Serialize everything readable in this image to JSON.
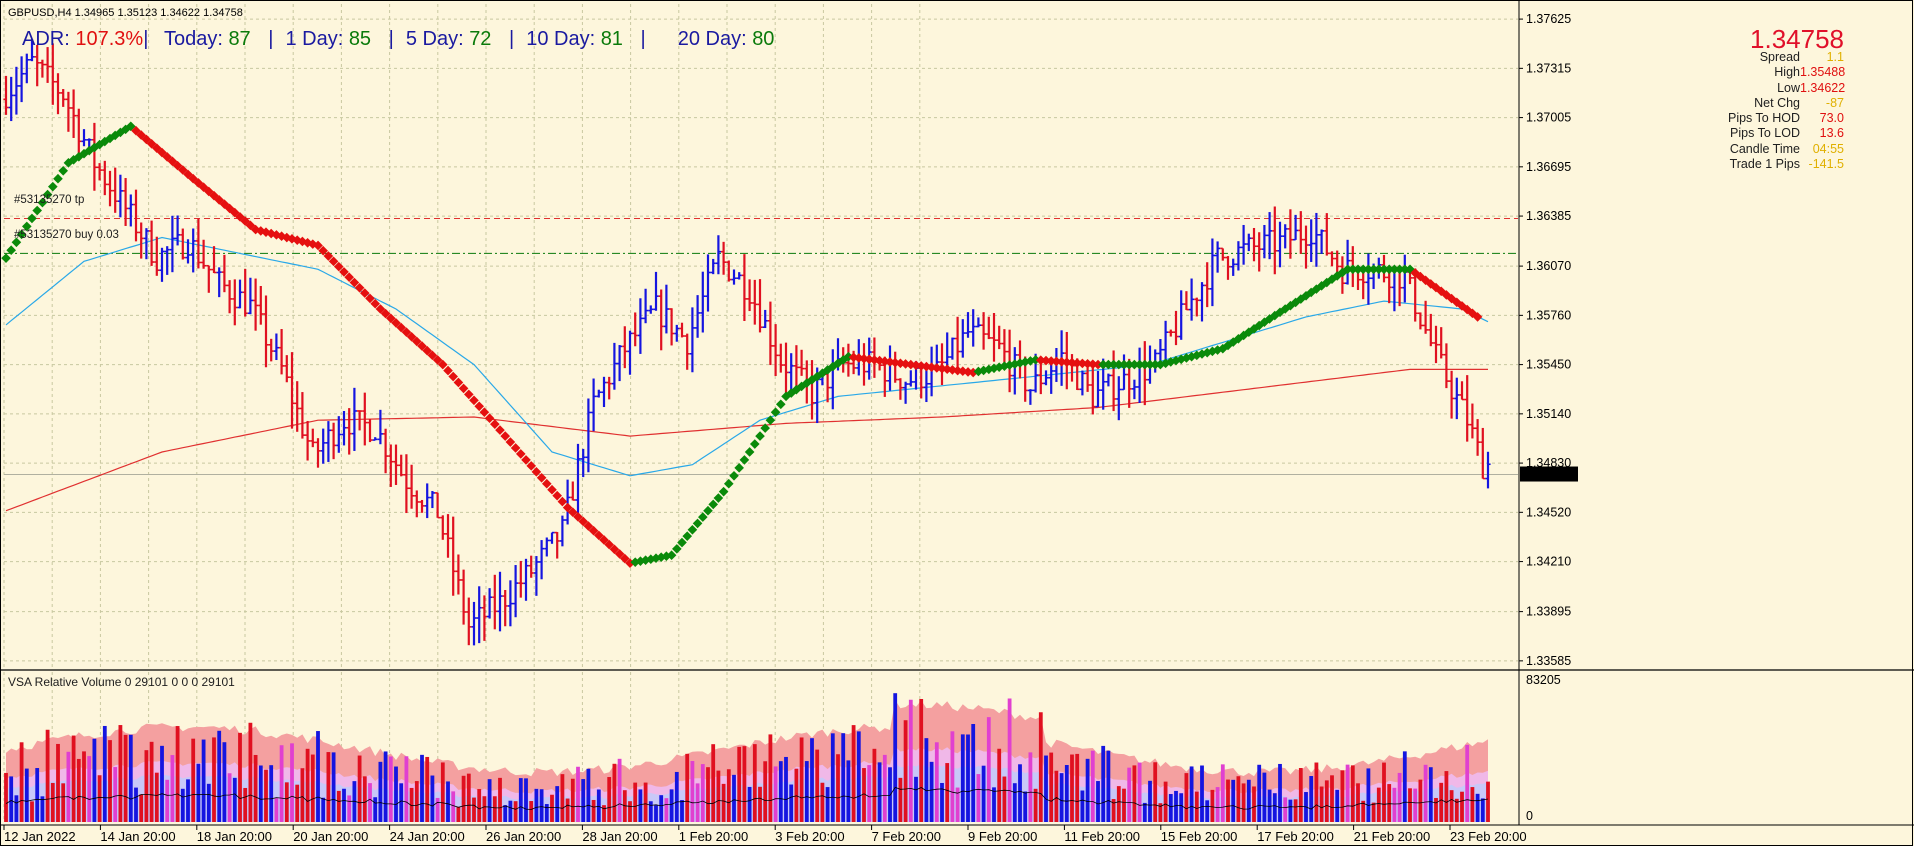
{
  "header": {
    "symbol_line": "GBPUSD,H4  1.34965 1.35123 1.34622 1.34758",
    "adr_label": "ADR: ",
    "adr_value": "107.3%",
    "today_label": "Today: ",
    "today_value": "87",
    "d1_label": "1 Day: ",
    "d1_value": "85",
    "d5_label": "5 Day: ",
    "d5_value": "72",
    "d10_label": "10 Day: ",
    "d10_value": "81",
    "d20_label": "20 Day: ",
    "d20_value": "80",
    "sep": "|"
  },
  "info_panel": {
    "price": "1.34758",
    "rows": [
      {
        "label": "Spread",
        "value": "1.1",
        "color": "yel"
      },
      {
        "label": "High",
        "value": "1.35488",
        "color": "red"
      },
      {
        "label": "Low",
        "value": "1.34622",
        "color": "red"
      },
      {
        "label": "Net Chg",
        "value": "-87",
        "color": "yel"
      },
      {
        "label": "Pips To HOD",
        "value": "73.0",
        "color": "red"
      },
      {
        "label": "Pips To LOD",
        "value": "13.6",
        "color": "red"
      },
      {
        "label": "Candle Time",
        "value": "04:55",
        "color": "yel"
      },
      {
        "label": "Trade 1 Pips",
        "value": "-141.5",
        "color": "yel"
      }
    ]
  },
  "orders": {
    "tp_label": "#53135270 tp",
    "buy_label": "#53135270 buy 0.03"
  },
  "volume_panel": {
    "title": "VSA Relative Volume 0 29101 0 0 0 29101",
    "axis_top": "83205",
    "axis_bottom": "0"
  },
  "colors": {
    "background": "#fdf6dc",
    "bull_bar": "#1515e0",
    "bear_bar": "#e01020",
    "ma_up": "#0a8a0a",
    "ma_down": "#e51010",
    "ma_fast": "#29a8e8",
    "ma_slow": "#e03030",
    "grid": "#c8c8a0",
    "vol_band_outer": "#f4a0a0",
    "vol_band_mid": "#f0b8e8",
    "vol_band_inner": "#c8c8f8",
    "vol_ma": "#000000"
  },
  "chart_data": {
    "type": "candlestick-bars",
    "symbol": "GBPUSD",
    "timeframe": "H4",
    "price_axis": {
      "ticks": [
        "1.37625",
        "1.37315",
        "1.37005",
        "1.36695",
        "1.36385",
        "1.36070",
        "1.35760",
        "1.35450",
        "1.35140",
        "1.34830",
        "1.34520",
        "1.34210",
        "1.33895",
        "1.33585"
      ],
      "ylim": [
        1.3354,
        1.3772
      ],
      "current_price": "1.34758"
    },
    "time_axis": {
      "ticks": [
        "12 Jan 2022",
        "14 Jan 20:00",
        "18 Jan 20:00",
        "20 Jan 20:00",
        "24 Jan 20:00",
        "26 Jan 20:00",
        "28 Jan 20:00",
        "1 Feb 20:00",
        "3 Feb 20:00",
        "7 Feb 20:00",
        "9 Feb 20:00",
        "11 Feb 20:00",
        "15 Feb 20:00",
        "17 Feb 20:00",
        "21 Feb 20:00",
        "23 Feb 20:00"
      ]
    },
    "levels": {
      "take_profit": 1.3637,
      "buy_entry": 1.3615
    },
    "price_anchors": [
      [
        0,
        1.3712
      ],
      [
        6,
        1.3735
      ],
      [
        12,
        1.3715
      ],
      [
        18,
        1.3672
      ],
      [
        24,
        1.3643
      ],
      [
        30,
        1.3612
      ],
      [
        36,
        1.3623
      ],
      [
        42,
        1.3596
      ],
      [
        48,
        1.3582
      ],
      [
        54,
        1.3542
      ],
      [
        60,
        1.3488
      ],
      [
        66,
        1.351
      ],
      [
        72,
        1.3505
      ],
      [
        78,
        1.3472
      ],
      [
        84,
        1.3452
      ],
      [
        90,
        1.338
      ],
      [
        96,
        1.3395
      ],
      [
        102,
        1.3415
      ],
      [
        108,
        1.344
      ],
      [
        114,
        1.352
      ],
      [
        120,
        1.3555
      ],
      [
        126,
        1.358
      ],
      [
        132,
        1.356
      ],
      [
        138,
        1.3612
      ],
      [
        144,
        1.3592
      ],
      [
        150,
        1.3548
      ],
      [
        156,
        1.3527
      ],
      [
        162,
        1.3545
      ],
      [
        168,
        1.3545
      ],
      [
        174,
        1.3535
      ],
      [
        180,
        1.354
      ],
      [
        186,
        1.3565
      ],
      [
        192,
        1.3555
      ],
      [
        198,
        1.353
      ],
      [
        204,
        1.355
      ],
      [
        210,
        1.3525
      ],
      [
        216,
        1.3535
      ],
      [
        222,
        1.3545
      ],
      [
        228,
        1.358
      ],
      [
        234,
        1.3612
      ],
      [
        240,
        1.3618
      ],
      [
        246,
        1.3622
      ],
      [
        252,
        1.363
      ],
      [
        258,
        1.3605
      ],
      [
        264,
        1.3605
      ],
      [
        270,
        1.36
      ],
      [
        276,
        1.355
      ],
      [
        282,
        1.351
      ],
      [
        285,
        1.3482
      ]
    ],
    "ma_trend_anchors": [
      [
        0,
        1.3612
      ],
      [
        12,
        1.3672
      ],
      [
        24,
        1.3695
      ],
      [
        36,
        1.3662
      ],
      [
        48,
        1.363
      ],
      [
        60,
        1.362
      ],
      [
        72,
        1.358
      ],
      [
        84,
        1.3545
      ],
      [
        96,
        1.35
      ],
      [
        108,
        1.3455
      ],
      [
        120,
        1.342
      ],
      [
        128,
        1.3425
      ],
      [
        138,
        1.3465
      ],
      [
        150,
        1.3525
      ],
      [
        162,
        1.355
      ],
      [
        174,
        1.3545
      ],
      [
        186,
        1.354
      ],
      [
        198,
        1.3548
      ],
      [
        210,
        1.3545
      ],
      [
        222,
        1.3545
      ],
      [
        234,
        1.3555
      ],
      [
        246,
        1.358
      ],
      [
        258,
        1.3605
      ],
      [
        270,
        1.3605
      ],
      [
        283,
        1.3575
      ]
    ],
    "ma_fast_anchors": [
      [
        0,
        1.357
      ],
      [
        15,
        1.361
      ],
      [
        30,
        1.3625
      ],
      [
        45,
        1.3615
      ],
      [
        60,
        1.3605
      ],
      [
        75,
        1.358
      ],
      [
        90,
        1.3545
      ],
      [
        105,
        1.349
      ],
      [
        120,
        1.3475
      ],
      [
        132,
        1.3482
      ],
      [
        145,
        1.351
      ],
      [
        160,
        1.3525
      ],
      [
        175,
        1.353
      ],
      [
        190,
        1.3535
      ],
      [
        205,
        1.354
      ],
      [
        220,
        1.3545
      ],
      [
        235,
        1.356
      ],
      [
        250,
        1.3575
      ],
      [
        265,
        1.3585
      ],
      [
        280,
        1.358
      ],
      [
        285,
        1.3572
      ]
    ],
    "ma_slow_anchors": [
      [
        0,
        1.3453
      ],
      [
        30,
        1.349
      ],
      [
        60,
        1.351
      ],
      [
        90,
        1.3512
      ],
      [
        120,
        1.35
      ],
      [
        150,
        1.3508
      ],
      [
        180,
        1.3512
      ],
      [
        210,
        1.3518
      ],
      [
        240,
        1.353
      ],
      [
        270,
        1.3542
      ],
      [
        285,
        1.3542
      ]
    ],
    "volume": {
      "bar_count": 286,
      "series": [
        "Relative volume",
        "Band outer",
        "Band middle",
        "Band inner",
        "Volume MA"
      ]
    }
  }
}
